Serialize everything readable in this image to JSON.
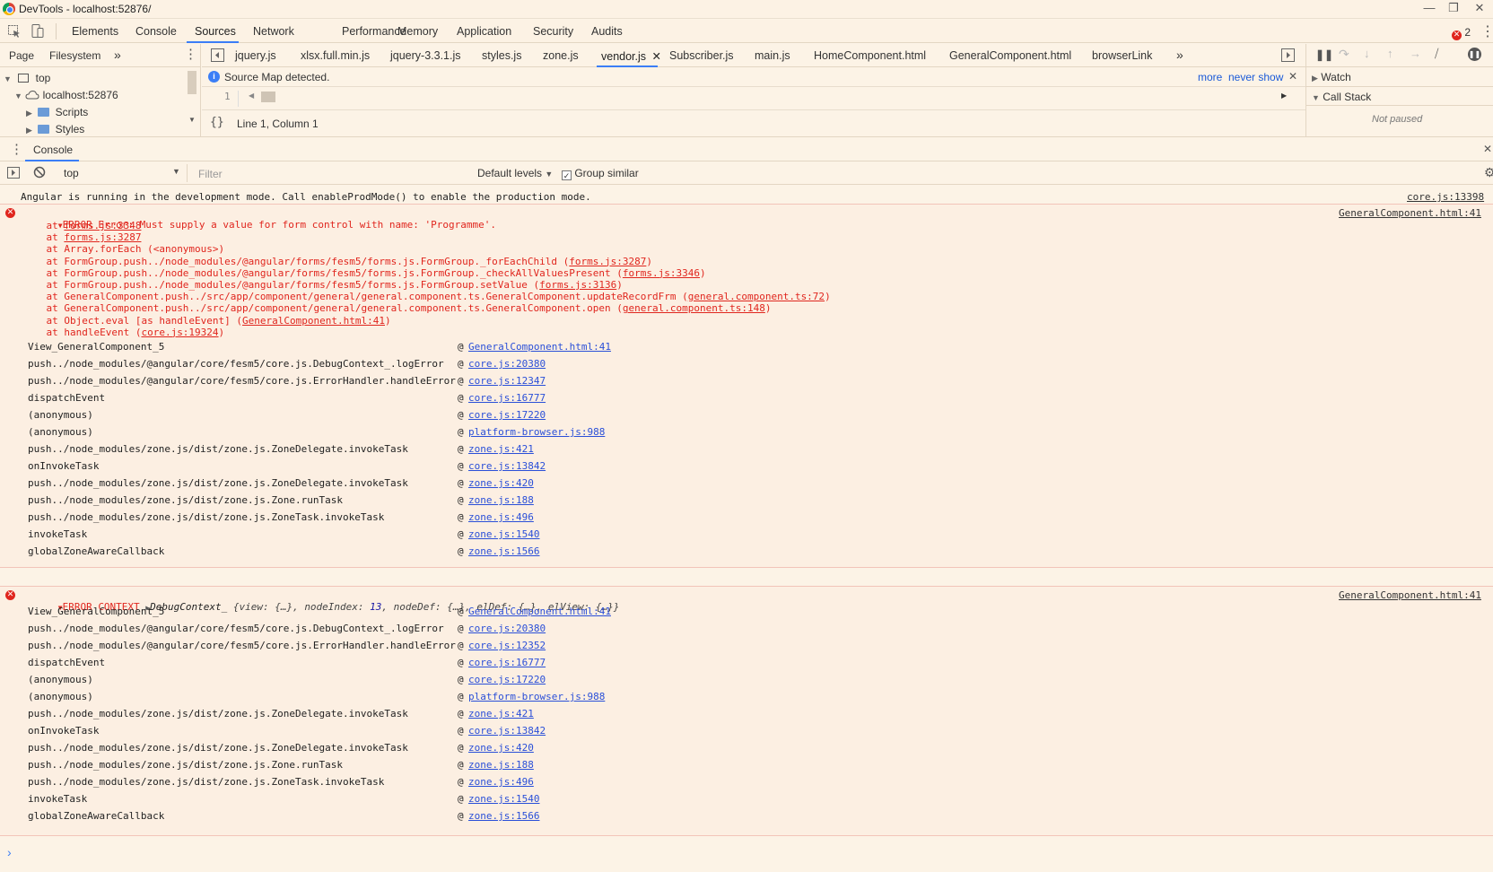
{
  "window": {
    "title": "DevTools - localhost:52876/"
  },
  "main_tabs": [
    "Elements",
    "Console",
    "Sources",
    "Network",
    "Performance",
    "Memory",
    "Application",
    "Security",
    "Audits"
  ],
  "error_count": "2",
  "navigator": {
    "tabs": [
      "Page",
      "Filesystem"
    ],
    "more": "»",
    "tree": {
      "top": "top",
      "host": "localhost:52876",
      "scripts": "Scripts",
      "styles": "Styles"
    }
  },
  "editor": {
    "tabs": [
      "jquery.js",
      "xlsx.full.min.js",
      "jquery-3.3.1.js",
      "styles.js",
      "zone.js",
      "vendor.js",
      "Subscriber.js",
      "main.js",
      "HomeComponent.html",
      "GeneralComponent.html",
      "browserLink"
    ],
    "active_tab": "vendor.js",
    "more": "»",
    "infobar": {
      "message": "Source Map detected.",
      "more": "more",
      "never_show": "never show"
    },
    "line_number": "1",
    "status": "Line 1, Column 1",
    "format_icon": "{}"
  },
  "debugger": {
    "watch": "Watch",
    "call_stack": "Call Stack",
    "not_paused": "Not paused"
  },
  "drawer": {
    "tab": "Console"
  },
  "console_toolbar": {
    "context": "top",
    "filter_placeholder": "Filter",
    "levels": "Default levels",
    "group_similar": "Group similar",
    "group_similar_checked": true
  },
  "console": {
    "info": {
      "text": "Angular is running in the development mode. Call enableProdMode() to enable the production mode.",
      "source": "core.js:13398"
    },
    "error1": {
      "header": "ERROR Error: Must supply a value for form control with name: 'Programme'.",
      "source": "GeneralComponent.html:41",
      "stack": [
        {
          "prefix": "    at ",
          "fn": "",
          "link": "forms.js:3348",
          "suffix": ""
        },
        {
          "prefix": "    at ",
          "fn": "",
          "link": "forms.js:3287",
          "suffix": ""
        },
        {
          "prefix": "    at ",
          "fn": "Array.forEach (<anonymous>)",
          "link": "",
          "suffix": ""
        },
        {
          "prefix": "    at ",
          "fn": "FormGroup.push../node_modules/@angular/forms/fesm5/forms.js.FormGroup._forEachChild (",
          "link": "forms.js:3287",
          "suffix": ")"
        },
        {
          "prefix": "    at ",
          "fn": "FormGroup.push../node_modules/@angular/forms/fesm5/forms.js.FormGroup._checkAllValuesPresent (",
          "link": "forms.js:3346",
          "suffix": ")"
        },
        {
          "prefix": "    at ",
          "fn": "FormGroup.push../node_modules/@angular/forms/fesm5/forms.js.FormGroup.setValue (",
          "link": "forms.js:3136",
          "suffix": ")"
        },
        {
          "prefix": "    at ",
          "fn": "GeneralComponent.push../src/app/component/general/general.component.ts.GeneralComponent.updateRecordFrm (",
          "link": "general.component.ts:72",
          "suffix": ")"
        },
        {
          "prefix": "    at ",
          "fn": "GeneralComponent.push../src/app/component/general/general.component.ts.GeneralComponent.open (",
          "link": "general.component.ts:148",
          "suffix": ")"
        },
        {
          "prefix": "    at ",
          "fn": "Object.eval [as handleEvent] (",
          "link": "GeneralComponent.html:41",
          "suffix": ")"
        },
        {
          "prefix": "    at ",
          "fn": "handleEvent (",
          "link": "core.js:19324",
          "suffix": ")"
        }
      ],
      "frames": [
        {
          "name": "View_GeneralComponent_5",
          "link": "GeneralComponent.html:41"
        },
        {
          "name": "push../node_modules/@angular/core/fesm5/core.js.DebugContext_.logError",
          "link": "core.js:20380"
        },
        {
          "name": "push../node_modules/@angular/core/fesm5/core.js.ErrorHandler.handleError",
          "link": "core.js:12347"
        },
        {
          "name": "dispatchEvent",
          "link": "core.js:16777"
        },
        {
          "name": "(anonymous)",
          "link": "core.js:17220"
        },
        {
          "name": "(anonymous)",
          "link": "platform-browser.js:988"
        },
        {
          "name": "push../node_modules/zone.js/dist/zone.js.ZoneDelegate.invokeTask",
          "link": "zone.js:421"
        },
        {
          "name": "onInvokeTask",
          "link": "core.js:13842"
        },
        {
          "name": "push../node_modules/zone.js/dist/zone.js.ZoneDelegate.invokeTask",
          "link": "zone.js:420"
        },
        {
          "name": "push../node_modules/zone.js/dist/zone.js.Zone.runTask",
          "link": "zone.js:188"
        },
        {
          "name": "push../node_modules/zone.js/dist/zone.js.ZoneTask.invokeTask",
          "link": "zone.js:496"
        },
        {
          "name": "invokeTask",
          "link": "zone.js:1540"
        },
        {
          "name": "globalZoneAwareCallback",
          "link": "zone.js:1566"
        }
      ]
    },
    "error2": {
      "label": "ERROR CONTEXT",
      "object_name": "DebugContext_",
      "object_preview_a": "{view: {…}, nodeIndex: ",
      "object_preview_num": "13",
      "object_preview_b": ", nodeDef: {…}, elDef: {…}, elView: {…}}",
      "source": "GeneralComponent.html:41",
      "frames": [
        {
          "name": "View_GeneralComponent_5",
          "link": "GeneralComponent.html:41"
        },
        {
          "name": "push../node_modules/@angular/core/fesm5/core.js.DebugContext_.logError",
          "link": "core.js:20380"
        },
        {
          "name": "push../node_modules/@angular/core/fesm5/core.js.ErrorHandler.handleError",
          "link": "core.js:12352"
        },
        {
          "name": "dispatchEvent",
          "link": "core.js:16777"
        },
        {
          "name": "(anonymous)",
          "link": "core.js:17220"
        },
        {
          "name": "(anonymous)",
          "link": "platform-browser.js:988"
        },
        {
          "name": "push../node_modules/zone.js/dist/zone.js.ZoneDelegate.invokeTask",
          "link": "zone.js:421"
        },
        {
          "name": "onInvokeTask",
          "link": "core.js:13842"
        },
        {
          "name": "push../node_modules/zone.js/dist/zone.js.ZoneDelegate.invokeTask",
          "link": "zone.js:420"
        },
        {
          "name": "push../node_modules/zone.js/dist/zone.js.Zone.runTask",
          "link": "zone.js:188"
        },
        {
          "name": "push../node_modules/zone.js/dist/zone.js.ZoneTask.invokeTask",
          "link": "zone.js:496"
        },
        {
          "name": "invokeTask",
          "link": "zone.js:1540"
        },
        {
          "name": "globalZoneAwareCallback",
          "link": "zone.js:1566"
        }
      ]
    },
    "prompt": "›"
  },
  "colors": {
    "background": "#fcf3e6",
    "error_text": "#e0261e",
    "link_blue": "#2a4fd8",
    "accent": "#3b7ef6"
  }
}
